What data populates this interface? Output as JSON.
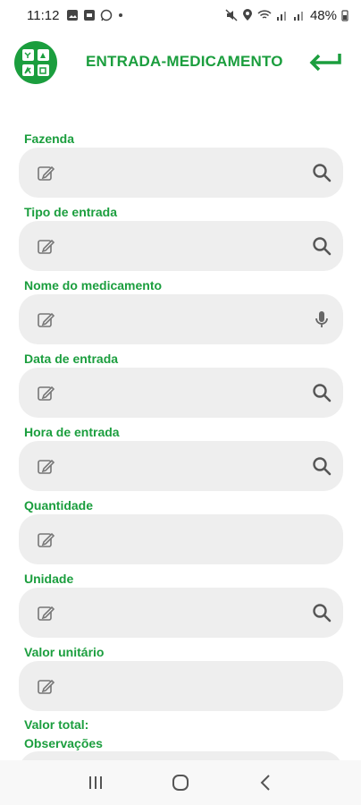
{
  "status": {
    "time": "11:12",
    "battery": "48%"
  },
  "header": {
    "title": "ENTRADA-MEDICAMENTO"
  },
  "fields": [
    {
      "label": "Fazenda",
      "value": "",
      "action_icon": "search-icon"
    },
    {
      "label": "Tipo de entrada",
      "value": "",
      "action_icon": "search-icon"
    },
    {
      "label": "Nome do medicamento",
      "value": "",
      "action_icon": "mic-icon"
    },
    {
      "label": "Data de entrada",
      "value": "",
      "action_icon": "search-icon"
    },
    {
      "label": "Hora de entrada",
      "value": "",
      "action_icon": "search-icon"
    },
    {
      "label": "Quantidade",
      "value": "",
      "action_icon": ""
    },
    {
      "label": "Unidade",
      "value": "",
      "action_icon": "search-icon"
    },
    {
      "label": "Valor unitário",
      "value": "",
      "action_icon": ""
    }
  ],
  "valor_total_label": "Valor total:",
  "observacoes_label": "Observações",
  "colors": {
    "accent": "#1b9e3e",
    "field_bg": "#eeeeee"
  }
}
